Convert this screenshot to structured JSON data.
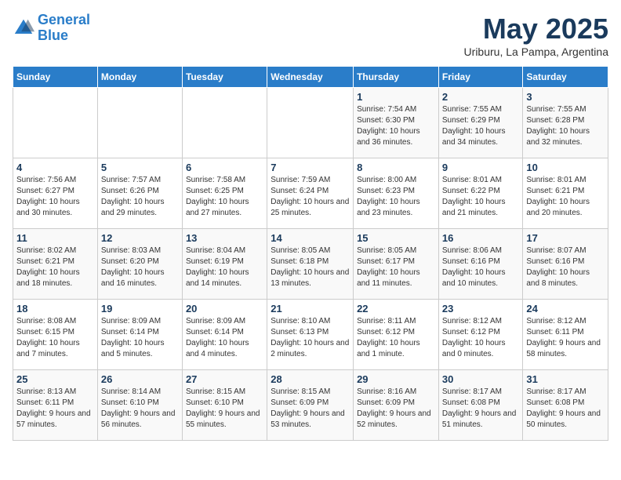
{
  "logo": {
    "line1": "General",
    "line2": "Blue"
  },
  "title": "May 2025",
  "subtitle": "Uriburu, La Pampa, Argentina",
  "weekdays": [
    "Sunday",
    "Monday",
    "Tuesday",
    "Wednesday",
    "Thursday",
    "Friday",
    "Saturday"
  ],
  "weeks": [
    [
      {
        "day": "",
        "info": ""
      },
      {
        "day": "",
        "info": ""
      },
      {
        "day": "",
        "info": ""
      },
      {
        "day": "",
        "info": ""
      },
      {
        "day": "1",
        "info": "Sunrise: 7:54 AM\nSunset: 6:30 PM\nDaylight: 10 hours and 36 minutes."
      },
      {
        "day": "2",
        "info": "Sunrise: 7:55 AM\nSunset: 6:29 PM\nDaylight: 10 hours and 34 minutes."
      },
      {
        "day": "3",
        "info": "Sunrise: 7:55 AM\nSunset: 6:28 PM\nDaylight: 10 hours and 32 minutes."
      }
    ],
    [
      {
        "day": "4",
        "info": "Sunrise: 7:56 AM\nSunset: 6:27 PM\nDaylight: 10 hours and 30 minutes."
      },
      {
        "day": "5",
        "info": "Sunrise: 7:57 AM\nSunset: 6:26 PM\nDaylight: 10 hours and 29 minutes."
      },
      {
        "day": "6",
        "info": "Sunrise: 7:58 AM\nSunset: 6:25 PM\nDaylight: 10 hours and 27 minutes."
      },
      {
        "day": "7",
        "info": "Sunrise: 7:59 AM\nSunset: 6:24 PM\nDaylight: 10 hours and 25 minutes."
      },
      {
        "day": "8",
        "info": "Sunrise: 8:00 AM\nSunset: 6:23 PM\nDaylight: 10 hours and 23 minutes."
      },
      {
        "day": "9",
        "info": "Sunrise: 8:01 AM\nSunset: 6:22 PM\nDaylight: 10 hours and 21 minutes."
      },
      {
        "day": "10",
        "info": "Sunrise: 8:01 AM\nSunset: 6:21 PM\nDaylight: 10 hours and 20 minutes."
      }
    ],
    [
      {
        "day": "11",
        "info": "Sunrise: 8:02 AM\nSunset: 6:21 PM\nDaylight: 10 hours and 18 minutes."
      },
      {
        "day": "12",
        "info": "Sunrise: 8:03 AM\nSunset: 6:20 PM\nDaylight: 10 hours and 16 minutes."
      },
      {
        "day": "13",
        "info": "Sunrise: 8:04 AM\nSunset: 6:19 PM\nDaylight: 10 hours and 14 minutes."
      },
      {
        "day": "14",
        "info": "Sunrise: 8:05 AM\nSunset: 6:18 PM\nDaylight: 10 hours and 13 minutes."
      },
      {
        "day": "15",
        "info": "Sunrise: 8:05 AM\nSunset: 6:17 PM\nDaylight: 10 hours and 11 minutes."
      },
      {
        "day": "16",
        "info": "Sunrise: 8:06 AM\nSunset: 6:16 PM\nDaylight: 10 hours and 10 minutes."
      },
      {
        "day": "17",
        "info": "Sunrise: 8:07 AM\nSunset: 6:16 PM\nDaylight: 10 hours and 8 minutes."
      }
    ],
    [
      {
        "day": "18",
        "info": "Sunrise: 8:08 AM\nSunset: 6:15 PM\nDaylight: 10 hours and 7 minutes."
      },
      {
        "day": "19",
        "info": "Sunrise: 8:09 AM\nSunset: 6:14 PM\nDaylight: 10 hours and 5 minutes."
      },
      {
        "day": "20",
        "info": "Sunrise: 8:09 AM\nSunset: 6:14 PM\nDaylight: 10 hours and 4 minutes."
      },
      {
        "day": "21",
        "info": "Sunrise: 8:10 AM\nSunset: 6:13 PM\nDaylight: 10 hours and 2 minutes."
      },
      {
        "day": "22",
        "info": "Sunrise: 8:11 AM\nSunset: 6:12 PM\nDaylight: 10 hours and 1 minute."
      },
      {
        "day": "23",
        "info": "Sunrise: 8:12 AM\nSunset: 6:12 PM\nDaylight: 10 hours and 0 minutes."
      },
      {
        "day": "24",
        "info": "Sunrise: 8:12 AM\nSunset: 6:11 PM\nDaylight: 9 hours and 58 minutes."
      }
    ],
    [
      {
        "day": "25",
        "info": "Sunrise: 8:13 AM\nSunset: 6:11 PM\nDaylight: 9 hours and 57 minutes."
      },
      {
        "day": "26",
        "info": "Sunrise: 8:14 AM\nSunset: 6:10 PM\nDaylight: 9 hours and 56 minutes."
      },
      {
        "day": "27",
        "info": "Sunrise: 8:15 AM\nSunset: 6:10 PM\nDaylight: 9 hours and 55 minutes."
      },
      {
        "day": "28",
        "info": "Sunrise: 8:15 AM\nSunset: 6:09 PM\nDaylight: 9 hours and 53 minutes."
      },
      {
        "day": "29",
        "info": "Sunrise: 8:16 AM\nSunset: 6:09 PM\nDaylight: 9 hours and 52 minutes."
      },
      {
        "day": "30",
        "info": "Sunrise: 8:17 AM\nSunset: 6:08 PM\nDaylight: 9 hours and 51 minutes."
      },
      {
        "day": "31",
        "info": "Sunrise: 8:17 AM\nSunset: 6:08 PM\nDaylight: 9 hours and 50 minutes."
      }
    ]
  ]
}
